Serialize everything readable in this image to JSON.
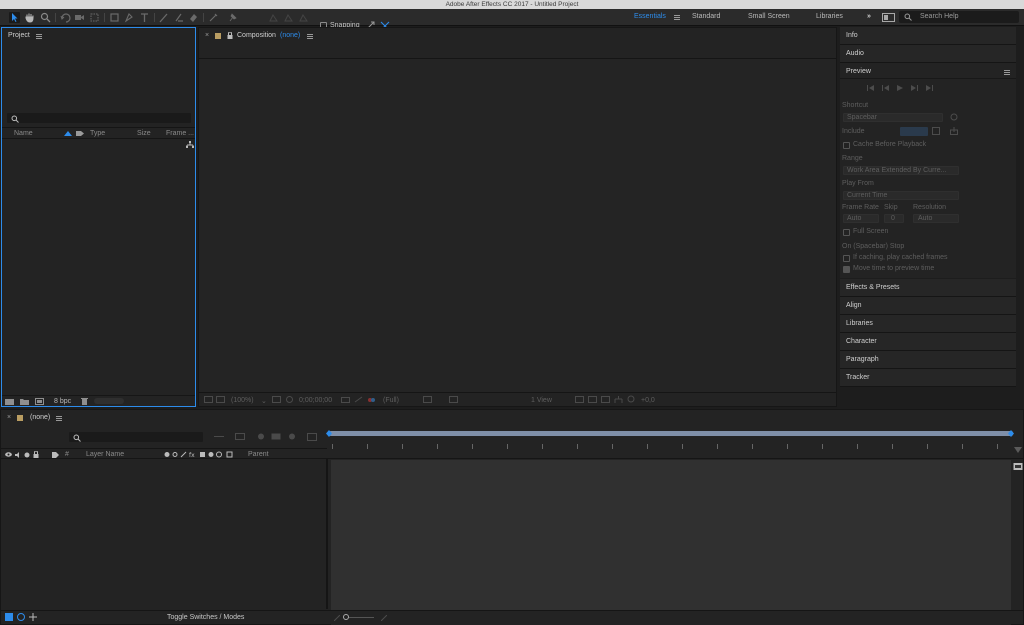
{
  "window": {
    "title": "Adobe After Effects CC 2017 - Untitled Project"
  },
  "toolbar": {
    "snapping_label": "Snapping",
    "workspaces": [
      "Essentials",
      "Standard",
      "Small Screen",
      "Libraries"
    ],
    "active_workspace": "Essentials",
    "search_placeholder": "Search Help",
    "overflow": "»"
  },
  "project": {
    "title": "Project",
    "columns": {
      "name": "Name",
      "type": "Type",
      "size": "Size",
      "frame": "Frame ..."
    },
    "bpc": "8 bpc"
  },
  "composition": {
    "title": "Composition",
    "comp_name": "(none)",
    "footer": {
      "zoom": "(100%)",
      "timecode": "0;00;00;00",
      "resolution": "(Full)",
      "view": "1 View",
      "offset": "+0,0"
    }
  },
  "right_panels": {
    "info": "Info",
    "audio": "Audio",
    "preview": {
      "title": "Preview",
      "shortcut_label": "Shortcut",
      "shortcut_value": "Spacebar",
      "include_label": "Include",
      "cache_before_playback": "Cache Before Playback",
      "range_label": "Range",
      "range_value": "Work Area Extended By Curre...",
      "play_from_label": "Play From",
      "play_from_value": "Current Time",
      "frame_rate_label": "Frame Rate",
      "skip_label": "Skip",
      "resolution_label": "Resolution",
      "frame_rate_value": "Auto",
      "skip_value": "0",
      "resolution_value": "Auto",
      "full_screen": "Full Screen",
      "on_stop_label": "On (Spacebar) Stop",
      "if_caching": "If caching, play cached frames",
      "move_time": "Move time to preview time"
    },
    "effects_presets": "Effects & Presets",
    "align": "Align",
    "libraries": "Libraries",
    "character": "Character",
    "paragraph": "Paragraph",
    "tracker": "Tracker"
  },
  "timeline": {
    "tab_label": "(none)",
    "columns": {
      "hash": "#",
      "layer_name": "Layer Name",
      "parent": "Parent"
    },
    "toggle_label": "Toggle Switches / Modes"
  },
  "colors": {
    "accent": "#2d8ceb",
    "panel_bg": "#232323",
    "title_bar": "#d9d9d9",
    "label_tan": "#b99d62"
  }
}
